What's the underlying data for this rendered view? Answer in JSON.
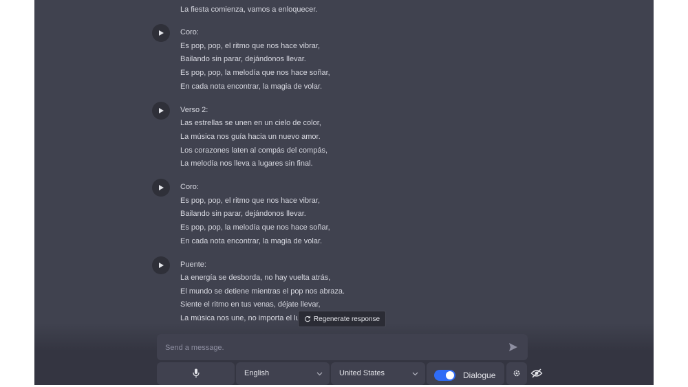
{
  "song": {
    "line0": "La fiesta comienza, vamos a enloquecer.",
    "sections": [
      {
        "lines": [
          "Coro:",
          "Es pop, pop, el ritmo que nos hace vibrar,",
          "Bailando sin parar, dejándonos llevar.",
          "Es pop, pop, la melodía que nos hace soñar,",
          "En cada nota encontrar, la magia de volar."
        ]
      },
      {
        "lines": [
          "Verso 2:",
          "Las estrellas se unen en un cielo de color,",
          "La música nos guía hacia un nuevo amor.",
          "Los corazones laten al compás del compás,",
          "La melodía nos lleva a lugares sin final."
        ]
      },
      {
        "lines": [
          "Coro:",
          "Es pop, pop, el ritmo que nos hace vibrar,",
          "Bailando sin parar, dejándonos llevar.",
          "Es pop, pop, la melodía que nos hace soñar,",
          "En cada nota encontrar, la magia de volar."
        ]
      },
      {
        "lines": [
          "Puente:",
          "La energía se desborda, no hay vuelta atrás,",
          "El mundo se detiene mientras el pop nos abraza.",
          "Siente el ritmo en tus venas, déjate llevar,",
          "La música nos une, no importa el lu"
        ]
      }
    ]
  },
  "regenerate": {
    "label": "Regenerate response",
    "icon": "refresh-icon"
  },
  "composer": {
    "placeholder": "Send a message.",
    "send_icon": "send-icon"
  },
  "controls": {
    "mic_icon": "microphone-icon",
    "language": "English",
    "region": "United States",
    "dialogue_label": "Dialogue",
    "dialogue_on": true,
    "accent_color": "#2f6cf6",
    "settings_icon": "gear-icon",
    "hide_icon": "eye-off-icon"
  }
}
